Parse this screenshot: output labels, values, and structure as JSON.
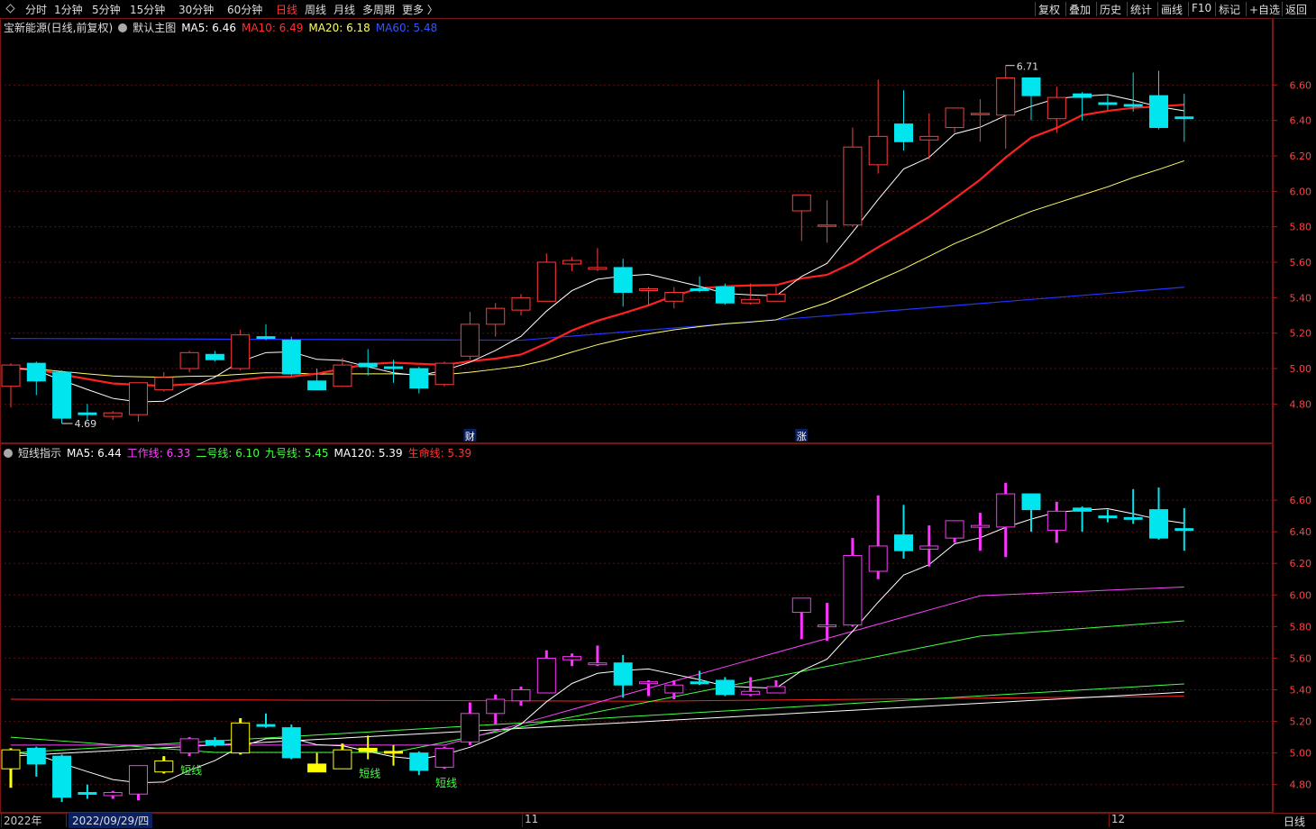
{
  "toolbar": {
    "left": [
      "分时",
      "1分钟",
      "5分钟",
      "15分钟",
      "30分钟",
      "60分钟",
      "日线",
      "周线",
      "月线",
      "多周期",
      "更多 〉"
    ],
    "active": "日线",
    "right": [
      "复权",
      "叠加",
      "历史",
      "统计",
      "画线",
      "F10",
      "标记",
      "+自选",
      "返回"
    ]
  },
  "main_legend": {
    "title": "宝新能源(日线,前复权)",
    "template": "默认主图",
    "ma5": "MA5: 6.46",
    "ma10": "MA10: 6.49",
    "ma20": "MA20: 6.18",
    "ma60": "MA60: 5.48"
  },
  "ind_legend": {
    "name": "短线指示",
    "ma5": "MA5: 6.44",
    "work": "工作线: 6.33",
    "line2": "二号线: 6.10",
    "line9": "九号线: 5.45",
    "ma120": "MA120: 5.39",
    "life": "生命线: 5.39"
  },
  "colors": {
    "up": "#ff3b3b",
    "down": "#00e5ee",
    "ma5": "#ffffff",
    "ma10": "#ff2020",
    "ma20": "#ffff66",
    "ma60": "#2233ff",
    "work": "#ff44ff",
    "line2": "#44ff44",
    "line9": "#44ff44",
    "ma120": "#ffffff",
    "life": "#ff2020"
  },
  "chart_data": {
    "type": "candlestick",
    "y_ticks_main": [
      6.6,
      6.4,
      6.2,
      6.0,
      5.8,
      5.6,
      5.4,
      5.2,
      5.0,
      4.8
    ],
    "y_ticks_ind": [
      6.6,
      6.4,
      6.2,
      6.0,
      5.8,
      5.6,
      5.4,
      5.2,
      5.0,
      4.8
    ],
    "ylim_main": [
      4.69,
      6.8
    ],
    "ylim_ind": [
      4.69,
      6.8
    ],
    "max_label": "6.71",
    "min_label": "4.69",
    "markers": [
      {
        "idx": 18,
        "text": "财"
      },
      {
        "idx": 31,
        "text": "涨"
      }
    ],
    "short_line_label": "短线",
    "short_line_idx": [
      7,
      14,
      17
    ],
    "x_labels": [
      {
        "idx": 0,
        "text": "2022年"
      },
      {
        "idx": 3,
        "text": "2022/09/29/四"
      },
      {
        "idx": 20,
        "text": "11"
      },
      {
        "idx": 43,
        "text": "12"
      }
    ],
    "period_label": "日线",
    "candles": [
      {
        "o": 4.9,
        "h": 5.03,
        "l": 4.78,
        "c": 5.02
      },
      {
        "o": 5.03,
        "h": 5.04,
        "l": 4.85,
        "c": 4.93
      },
      {
        "o": 4.98,
        "h": 4.99,
        "l": 4.69,
        "c": 4.72
      },
      {
        "o": 4.75,
        "h": 4.8,
        "l": 4.71,
        "c": 4.74
      },
      {
        "o": 4.73,
        "h": 4.76,
        "l": 4.71,
        "c": 4.75
      },
      {
        "o": 4.74,
        "h": 4.92,
        "l": 4.7,
        "c": 4.92
      },
      {
        "o": 4.88,
        "h": 4.98,
        "l": 4.87,
        "c": 4.95
      },
      {
        "o": 5.0,
        "h": 5.1,
        "l": 4.98,
        "c": 5.09
      },
      {
        "o": 5.08,
        "h": 5.1,
        "l": 5.04,
        "c": 5.05
      },
      {
        "o": 5.0,
        "h": 5.22,
        "l": 4.99,
        "c": 5.19
      },
      {
        "o": 5.18,
        "h": 5.25,
        "l": 5.16,
        "c": 5.17
      },
      {
        "o": 5.16,
        "h": 5.18,
        "l": 4.96,
        "c": 4.97
      },
      {
        "o": 4.93,
        "h": 5.0,
        "l": 4.89,
        "c": 4.88
      },
      {
        "o": 4.9,
        "h": 5.06,
        "l": 4.9,
        "c": 5.02
      },
      {
        "o": 5.03,
        "h": 5.11,
        "l": 4.96,
        "c": 5.01
      },
      {
        "o": 5.01,
        "h": 5.05,
        "l": 4.92,
        "c": 5.0
      },
      {
        "o": 5.0,
        "h": 5.01,
        "l": 4.86,
        "c": 4.89
      },
      {
        "o": 4.91,
        "h": 5.04,
        "l": 4.9,
        "c": 5.03
      },
      {
        "o": 5.07,
        "h": 5.32,
        "l": 5.05,
        "c": 5.25
      },
      {
        "o": 5.25,
        "h": 5.37,
        "l": 5.18,
        "c": 5.34
      },
      {
        "o": 5.33,
        "h": 5.42,
        "l": 5.3,
        "c": 5.4
      },
      {
        "o": 5.38,
        "h": 5.65,
        "l": 5.38,
        "c": 5.6
      },
      {
        "o": 5.59,
        "h": 5.63,
        "l": 5.55,
        "c": 5.61
      },
      {
        "o": 5.56,
        "h": 5.68,
        "l": 5.55,
        "c": 5.57
      },
      {
        "o": 5.57,
        "h": 5.62,
        "l": 5.35,
        "c": 5.43
      },
      {
        "o": 5.44,
        "h": 5.46,
        "l": 5.36,
        "c": 5.45
      },
      {
        "o": 5.38,
        "h": 5.46,
        "l": 5.34,
        "c": 5.43
      },
      {
        "o": 5.45,
        "h": 5.52,
        "l": 5.43,
        "c": 5.44
      },
      {
        "o": 5.46,
        "h": 5.48,
        "l": 5.36,
        "c": 5.37
      },
      {
        "o": 5.37,
        "h": 5.48,
        "l": 5.36,
        "c": 5.39
      },
      {
        "o": 5.38,
        "h": 5.46,
        "l": 5.38,
        "c": 5.42
      },
      {
        "o": 5.89,
        "h": 5.89,
        "l": 5.72,
        "c": 5.98
      },
      {
        "o": 5.81,
        "h": 5.95,
        "l": 5.71,
        "c": 5.81
      },
      {
        "o": 5.81,
        "h": 6.36,
        "l": 5.8,
        "c": 6.25
      },
      {
        "o": 6.15,
        "h": 6.63,
        "l": 6.1,
        "c": 6.31
      },
      {
        "o": 6.38,
        "h": 6.57,
        "l": 6.23,
        "c": 6.28
      },
      {
        "o": 6.29,
        "h": 6.44,
        "l": 6.18,
        "c": 6.31
      },
      {
        "o": 6.36,
        "h": 6.47,
        "l": 6.33,
        "c": 6.47
      },
      {
        "o": 6.44,
        "h": 6.52,
        "l": 6.28,
        "c": 6.44
      },
      {
        "o": 6.43,
        "h": 6.71,
        "l": 6.24,
        "c": 6.64
      },
      {
        "o": 6.64,
        "h": 6.64,
        "l": 6.4,
        "c": 6.54
      },
      {
        "o": 6.41,
        "h": 6.59,
        "l": 6.33,
        "c": 6.53
      },
      {
        "o": 6.55,
        "h": 6.56,
        "l": 6.4,
        "c": 6.53
      },
      {
        "o": 6.5,
        "h": 6.54,
        "l": 6.46,
        "c": 6.49
      },
      {
        "o": 6.49,
        "h": 6.67,
        "l": 6.45,
        "c": 6.48
      },
      {
        "o": 6.54,
        "h": 6.68,
        "l": 6.35,
        "c": 6.36
      },
      {
        "o": 6.42,
        "h": 6.55,
        "l": 6.28,
        "c": 6.41
      }
    ]
  }
}
